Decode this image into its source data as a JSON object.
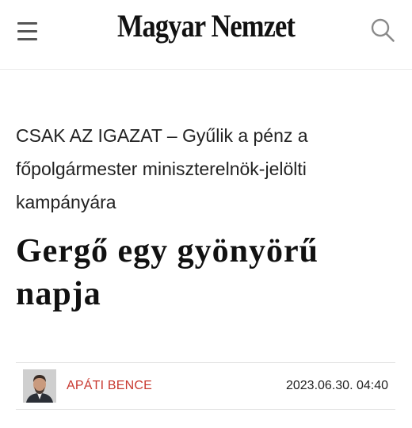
{
  "header": {
    "logo_text": "Magyar Nemzet",
    "menu_icon": "hamburger-menu-icon",
    "search_icon": "search-icon"
  },
  "article": {
    "kicker": "CSAK AZ IGAZAT – Gyűlik a pénz a főpolgármester miniszterelnök-jelölti kampányára",
    "headline": "Gergő egy gyönyörű napja",
    "author": "APÁTI BENCE",
    "date": "2023.06.30. 04:40"
  },
  "colors": {
    "author_link": "#c8382f",
    "text": "#222222",
    "icon_gray": "#555555"
  }
}
